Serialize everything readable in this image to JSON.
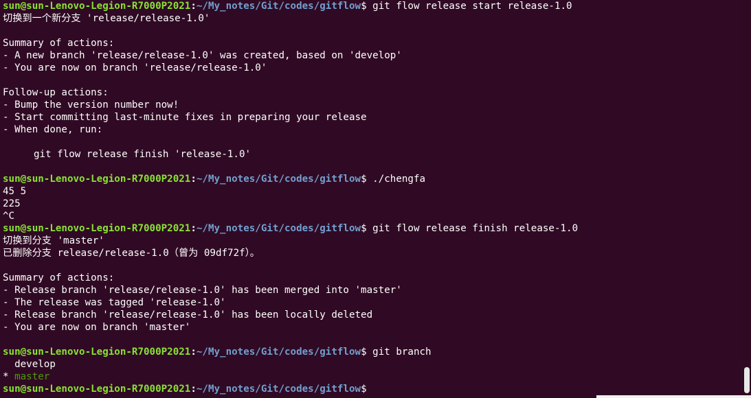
{
  "prompt": {
    "user_host": "sun@sun-Lenovo-Legion-R7000P2021",
    "sep": ":",
    "path": "~/My_notes/Git/codes/gitflow",
    "dollar": "$"
  },
  "commands": {
    "c1": "git flow release start release-1.0",
    "c2": "./chengfa",
    "c3": "git flow release finish release-1.0",
    "c4": "git branch"
  },
  "output": {
    "l2": "切换到一个新分支 'release/release-1.0'",
    "l4": "Summary of actions:",
    "l5": "- A new branch 'release/release-1.0' was created, based on 'develop'",
    "l6": "- You are now on branch 'release/release-1.0'",
    "l8": "Follow-up actions:",
    "l9": "- Bump the version number now!",
    "l10": "- Start committing last-minute fixes in preparing your release",
    "l11": "- When done, run:",
    "l13": "git flow release finish 'release-1.0'",
    "l16": "45 5",
    "l17": "225",
    "l18": "^C",
    "l20": "切换到分支 'master'",
    "l21": "已删除分支 release/release-1.0（曾为 09df72f）。",
    "l23": "Summary of actions:",
    "l24": "- Release branch 'release/release-1.0' has been merged into 'master'",
    "l25": "- The release was tagged 'release-1.0'",
    "l26": "- Release branch 'release/release-1.0' has been locally deleted",
    "l27": "- You are now on branch 'master'",
    "l30": "  develop",
    "l31_marker": "* ",
    "l31_branch": "master"
  },
  "colors": {
    "background": "#300a24",
    "prompt_user": "#8ae234",
    "prompt_path": "#729fcf",
    "current_branch": "#4e9a06",
    "text": "#ffffff"
  }
}
